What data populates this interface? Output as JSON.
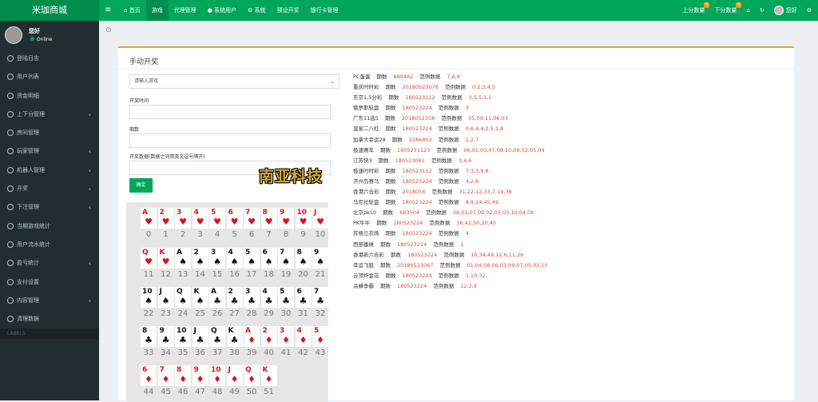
{
  "header": {
    "logo": "米珈商城",
    "toggle": "≡",
    "nav": [
      {
        "icon": "home-icon",
        "glyph": "⌂",
        "label": "首页"
      },
      {
        "label": "游戏",
        "active": true
      },
      {
        "label": "代理管理"
      },
      {
        "icon": "user-icon",
        "glyph": "●",
        "label": "系统用户"
      },
      {
        "icon": "gear-icon",
        "glyph": "⚙",
        "label": "系统"
      },
      {
        "label": "预设开奖"
      },
      {
        "label": "银行卡管理"
      }
    ],
    "right": {
      "score_up": "上分数量",
      "score_up_badge": "0",
      "score_down": "下分数量",
      "score_down_badge": "0",
      "home_glyph": "⌂",
      "refresh_glyph": "↻",
      "user": "您好",
      "settings_glyph": "⚙"
    }
  },
  "sidebar": {
    "user": {
      "name": "您好",
      "status": "Online"
    },
    "items": [
      {
        "label": "登陆日志"
      },
      {
        "label": "用户列表"
      },
      {
        "label": "资金明细"
      },
      {
        "label": "上下分管理",
        "arrow": "‹"
      },
      {
        "label": "房间管理"
      },
      {
        "label": "玩家管理",
        "arrow": "‹"
      },
      {
        "label": "机器人管理",
        "arrow": "‹"
      },
      {
        "label": "开奖",
        "arrow": "‹"
      },
      {
        "label": "下注管理",
        "arrow": "‹"
      },
      {
        "label": "当期游戏统计"
      },
      {
        "label": "用户流水统计"
      },
      {
        "label": "盈亏统计",
        "arrow": "‹"
      },
      {
        "label": "支付设置"
      },
      {
        "label": "内容管理",
        "arrow": "‹"
      },
      {
        "label": "清理数据"
      }
    ],
    "labels_header": "LABELS"
  },
  "breadcrumb": "⊙",
  "panel": {
    "title": "手动开奖",
    "game_select": {
      "placeholder": "请输入游戏",
      "caret": "⌄"
    },
    "field_time": "开奖时间",
    "field_period": "期数",
    "field_numbers": "开奖数据(数据之间用英文逗号隔开)",
    "submit": "确定",
    "watermark": "南亚科技"
  },
  "cards": [
    {
      "rank": "A",
      "suit": "♥",
      "num": "0"
    },
    {
      "rank": "2",
      "suit": "♥",
      "num": "1"
    },
    {
      "rank": "3",
      "suit": "♥",
      "num": "2"
    },
    {
      "rank": "4",
      "suit": "♥",
      "num": "3"
    },
    {
      "rank": "5",
      "suit": "♥",
      "num": "4"
    },
    {
      "rank": "6",
      "suit": "♥",
      "num": "5"
    },
    {
      "rank": "7",
      "suit": "♥",
      "num": "6"
    },
    {
      "rank": "8",
      "suit": "♥",
      "num": "7"
    },
    {
      "rank": "9",
      "suit": "♥",
      "num": "8"
    },
    {
      "rank": "10",
      "suit": "♥",
      "num": "9"
    },
    {
      "rank": "J",
      "suit": "♥",
      "num": "10"
    },
    {
      "rank": "Q",
      "suit": "♥",
      "num": "11"
    },
    {
      "rank": "K",
      "suit": "♥",
      "num": "12"
    },
    {
      "rank": "A",
      "suit": "♠",
      "num": "13"
    },
    {
      "rank": "2",
      "suit": "♠",
      "num": "14"
    },
    {
      "rank": "3",
      "suit": "♠",
      "num": "15"
    },
    {
      "rank": "4",
      "suit": "♠",
      "num": "16"
    },
    {
      "rank": "5",
      "suit": "♠",
      "num": "17"
    },
    {
      "rank": "6",
      "suit": "♠",
      "num": "18"
    },
    {
      "rank": "7",
      "suit": "♠",
      "num": "19"
    },
    {
      "rank": "8",
      "suit": "♠",
      "num": "20"
    },
    {
      "rank": "9",
      "suit": "♠",
      "num": "21"
    },
    {
      "rank": "10",
      "suit": "♠",
      "num": "22"
    },
    {
      "rank": "J",
      "suit": "♠",
      "num": "23"
    },
    {
      "rank": "Q",
      "suit": "♠",
      "num": "24"
    },
    {
      "rank": "K",
      "suit": "♠",
      "num": "25"
    },
    {
      "rank": "A",
      "suit": "♣",
      "num": "26"
    },
    {
      "rank": "2",
      "suit": "♣",
      "num": "27"
    },
    {
      "rank": "3",
      "suit": "♣",
      "num": "28"
    },
    {
      "rank": "4",
      "suit": "♣",
      "num": "29"
    },
    {
      "rank": "5",
      "suit": "♣",
      "num": "30"
    },
    {
      "rank": "6",
      "suit": "♣",
      "num": "31"
    },
    {
      "rank": "7",
      "suit": "♣",
      "num": "32"
    },
    {
      "rank": "8",
      "suit": "♣",
      "num": "33"
    },
    {
      "rank": "9",
      "suit": "♣",
      "num": "34"
    },
    {
      "rank": "10",
      "suit": "♣",
      "num": "35"
    },
    {
      "rank": "J",
      "suit": "♣",
      "num": "36"
    },
    {
      "rank": "Q",
      "suit": "♣",
      "num": "37"
    },
    {
      "rank": "K",
      "suit": "♣",
      "num": "38"
    },
    {
      "rank": "A",
      "suit": "♦",
      "num": "39"
    },
    {
      "rank": "2",
      "suit": "♦",
      "num": "40"
    },
    {
      "rank": "3",
      "suit": "♦",
      "num": "41"
    },
    {
      "rank": "4",
      "suit": "♦",
      "num": "42"
    },
    {
      "rank": "5",
      "suit": "♦",
      "num": "43"
    },
    {
      "rank": "6",
      "suit": "♦",
      "num": "44"
    },
    {
      "rank": "7",
      "suit": "♦",
      "num": "45"
    },
    {
      "rank": "8",
      "suit": "♦",
      "num": "46"
    },
    {
      "rank": "9",
      "suit": "♦",
      "num": "47"
    },
    {
      "rank": "10",
      "suit": "♦",
      "num": "48"
    },
    {
      "rank": "J",
      "suit": "♦",
      "num": "49"
    },
    {
      "rank": "Q",
      "suit": "♦",
      "num": "50"
    },
    {
      "rank": "K",
      "suit": "♦",
      "num": "51"
    }
  ],
  "games": [
    {
      "name": "PC蛋蛋",
      "period_label": "期数",
      "period": "889482",
      "sample_label": "范例数据",
      "sample": "7,4,9"
    },
    {
      "name": "重庆时时彩",
      "period_label": "期数",
      "period": "20180523076",
      "sample_label": "范例数据",
      "sample": "0,2,3,4,5"
    },
    {
      "name": "东京1.5分彩",
      "period_label": "期数",
      "period": "180523112",
      "sample_label": "范例数据",
      "sample": "3,5,5,1,1"
    },
    {
      "name": "俄罗斯轮盘",
      "period_label": "期数",
      "period": "180523224",
      "sample_label": "范例数据",
      "sample": "3"
    },
    {
      "name": "广东11选5",
      "period_label": "期数",
      "period": "2018052358",
      "sample_label": "范例数据",
      "sample": "05,09,11,06,03"
    },
    {
      "name": "皇家二八杠",
      "period_label": "期数",
      "period": "180523224",
      "sample_label": "范例数据",
      "sample": "0,6,4,4,2,5,1,8"
    },
    {
      "name": "加拿大幸运28",
      "period_label": "期数",
      "period": "2286803",
      "sample_label": "范例数据",
      "sample": "1,2,7"
    },
    {
      "name": "极速赛车",
      "period_label": "期数",
      "period": "1805231123",
      "sample_label": "范例数据",
      "sample": "06,01,03,07,08,10,09,02,05,04"
    },
    {
      "name": "江苏快3",
      "period_label": "期数",
      "period": "180523061",
      "sample_label": "范例数据",
      "sample": "3,4,6"
    },
    {
      "name": "极速时时彩",
      "period_label": "期数",
      "period": "180523112",
      "sample_label": "范例数据",
      "sample": "7,3,3,9,8"
    },
    {
      "name": "济州岛赛马",
      "period_label": "期数",
      "period": "180523224",
      "sample_label": "范例数据",
      "sample": "4,2,6"
    },
    {
      "name": "香港六合彩",
      "period_label": "期数",
      "period": "2018056",
      "sample_label": "范例数据",
      "sample": "31,22,12,33,7,14,38"
    },
    {
      "name": "马尼拉轮盘",
      "period_label": "期数",
      "period": "180523224",
      "sample_label": "范例数据",
      "sample": "8,9,14,45,49"
    },
    {
      "name": "北京pk10",
      "period_label": "期数",
      "period": "683504",
      "sample_label": "范例数据",
      "sample": "06,01,07,09,02,05,03,10,04,08"
    },
    {
      "name": "PK牛牛",
      "period_label": "期数",
      "period": "180523224",
      "sample_label": "范例数据",
      "sample": "36,42,50,20,40"
    },
    {
      "name": "苏格兰农场",
      "period_label": "期数",
      "period": "180523224",
      "sample_label": "范例数据",
      "sample": "4"
    },
    {
      "name": "西部番摊",
      "period_label": "期数",
      "period": "180523224",
      "sample_label": "范例数据",
      "sample": "1"
    },
    {
      "name": "香港新六合彩",
      "period_label": "期数",
      "period": "180523224",
      "sample_label": "范例数据",
      "sample": "16,34,49,12,6,11,26"
    },
    {
      "name": "幸运飞艇",
      "period_label": "期数",
      "period": "20180523067",
      "sample_label": "范例数据",
      "sample": "01,04,08,06,03,09,07,05,02,10"
    },
    {
      "name": "云顶炸金花",
      "period_label": "期数",
      "period": "180523224",
      "sample_label": "范例数据",
      "sample": "1,10,32"
    },
    {
      "name": "涂蜂争霸",
      "period_label": "期数",
      "period": "180523224",
      "sample_label": "范例数据",
      "sample": "12,2,8"
    }
  ]
}
